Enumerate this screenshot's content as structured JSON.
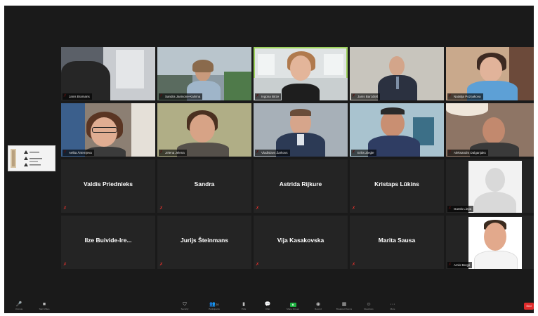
{
  "video_tiles": [
    {
      "name": "Janis Bramans"
    },
    {
      "name": "Sandra Janisone-Kalnina"
    },
    {
      "name": "Ingūna Birze"
    },
    {
      "name": "Janis Barzdiņš"
    },
    {
      "name": "Natalija Pozņakova"
    },
    {
      "name": "Aelita Ārtemjeva"
    },
    {
      "name": "Jelena Jelena"
    },
    {
      "name": "Vladislavs Žarkovs"
    },
    {
      "name": "Eriks Ziegle"
    },
    {
      "name": "Aleksandrs Dalganjaks"
    }
  ],
  "name_tiles": [
    {
      "name": "Valdis Priednieks"
    },
    {
      "name": "Sandra"
    },
    {
      "name": "Astrida Rijkure"
    },
    {
      "name": "Kristaps Lūkins"
    },
    {
      "name": "Ilze  Buivide-Ire..."
    },
    {
      "name": "Jurijs Šteinmans"
    },
    {
      "name": "Vija Kasakovska"
    },
    {
      "name": "Marita Sausa"
    }
  ],
  "avatar_tiles": [
    {
      "name": "Guntis Liepa"
    },
    {
      "name": "Arnis Bergs"
    }
  ],
  "toolbar": {
    "items": [
      {
        "icon": "microphone-icon",
        "label": "Unmute"
      },
      {
        "icon": "video-camera-icon",
        "label": "Start Video"
      },
      {
        "icon": "shield-icon",
        "label": "Security"
      },
      {
        "icon": "participants-icon",
        "label": "Participants",
        "count": "20"
      },
      {
        "icon": "polls-icon",
        "label": "Polls"
      },
      {
        "icon": "chat-icon",
        "label": "Chat"
      },
      {
        "icon": "share-screen-icon",
        "label": "Share Screen"
      },
      {
        "icon": "record-icon",
        "label": "Record"
      },
      {
        "icon": "breakout-rooms-icon",
        "label": "Breakout Rooms"
      },
      {
        "icon": "reactions-icon",
        "label": "Reactions"
      },
      {
        "icon": "more-icon",
        "label": "More"
      }
    ],
    "end_label": "End"
  },
  "colors": {
    "active_speaker": "#9ed35f",
    "muted_icon": "#e5322d",
    "end_button": "#e02b2b",
    "share_screen": "#1fb141"
  }
}
